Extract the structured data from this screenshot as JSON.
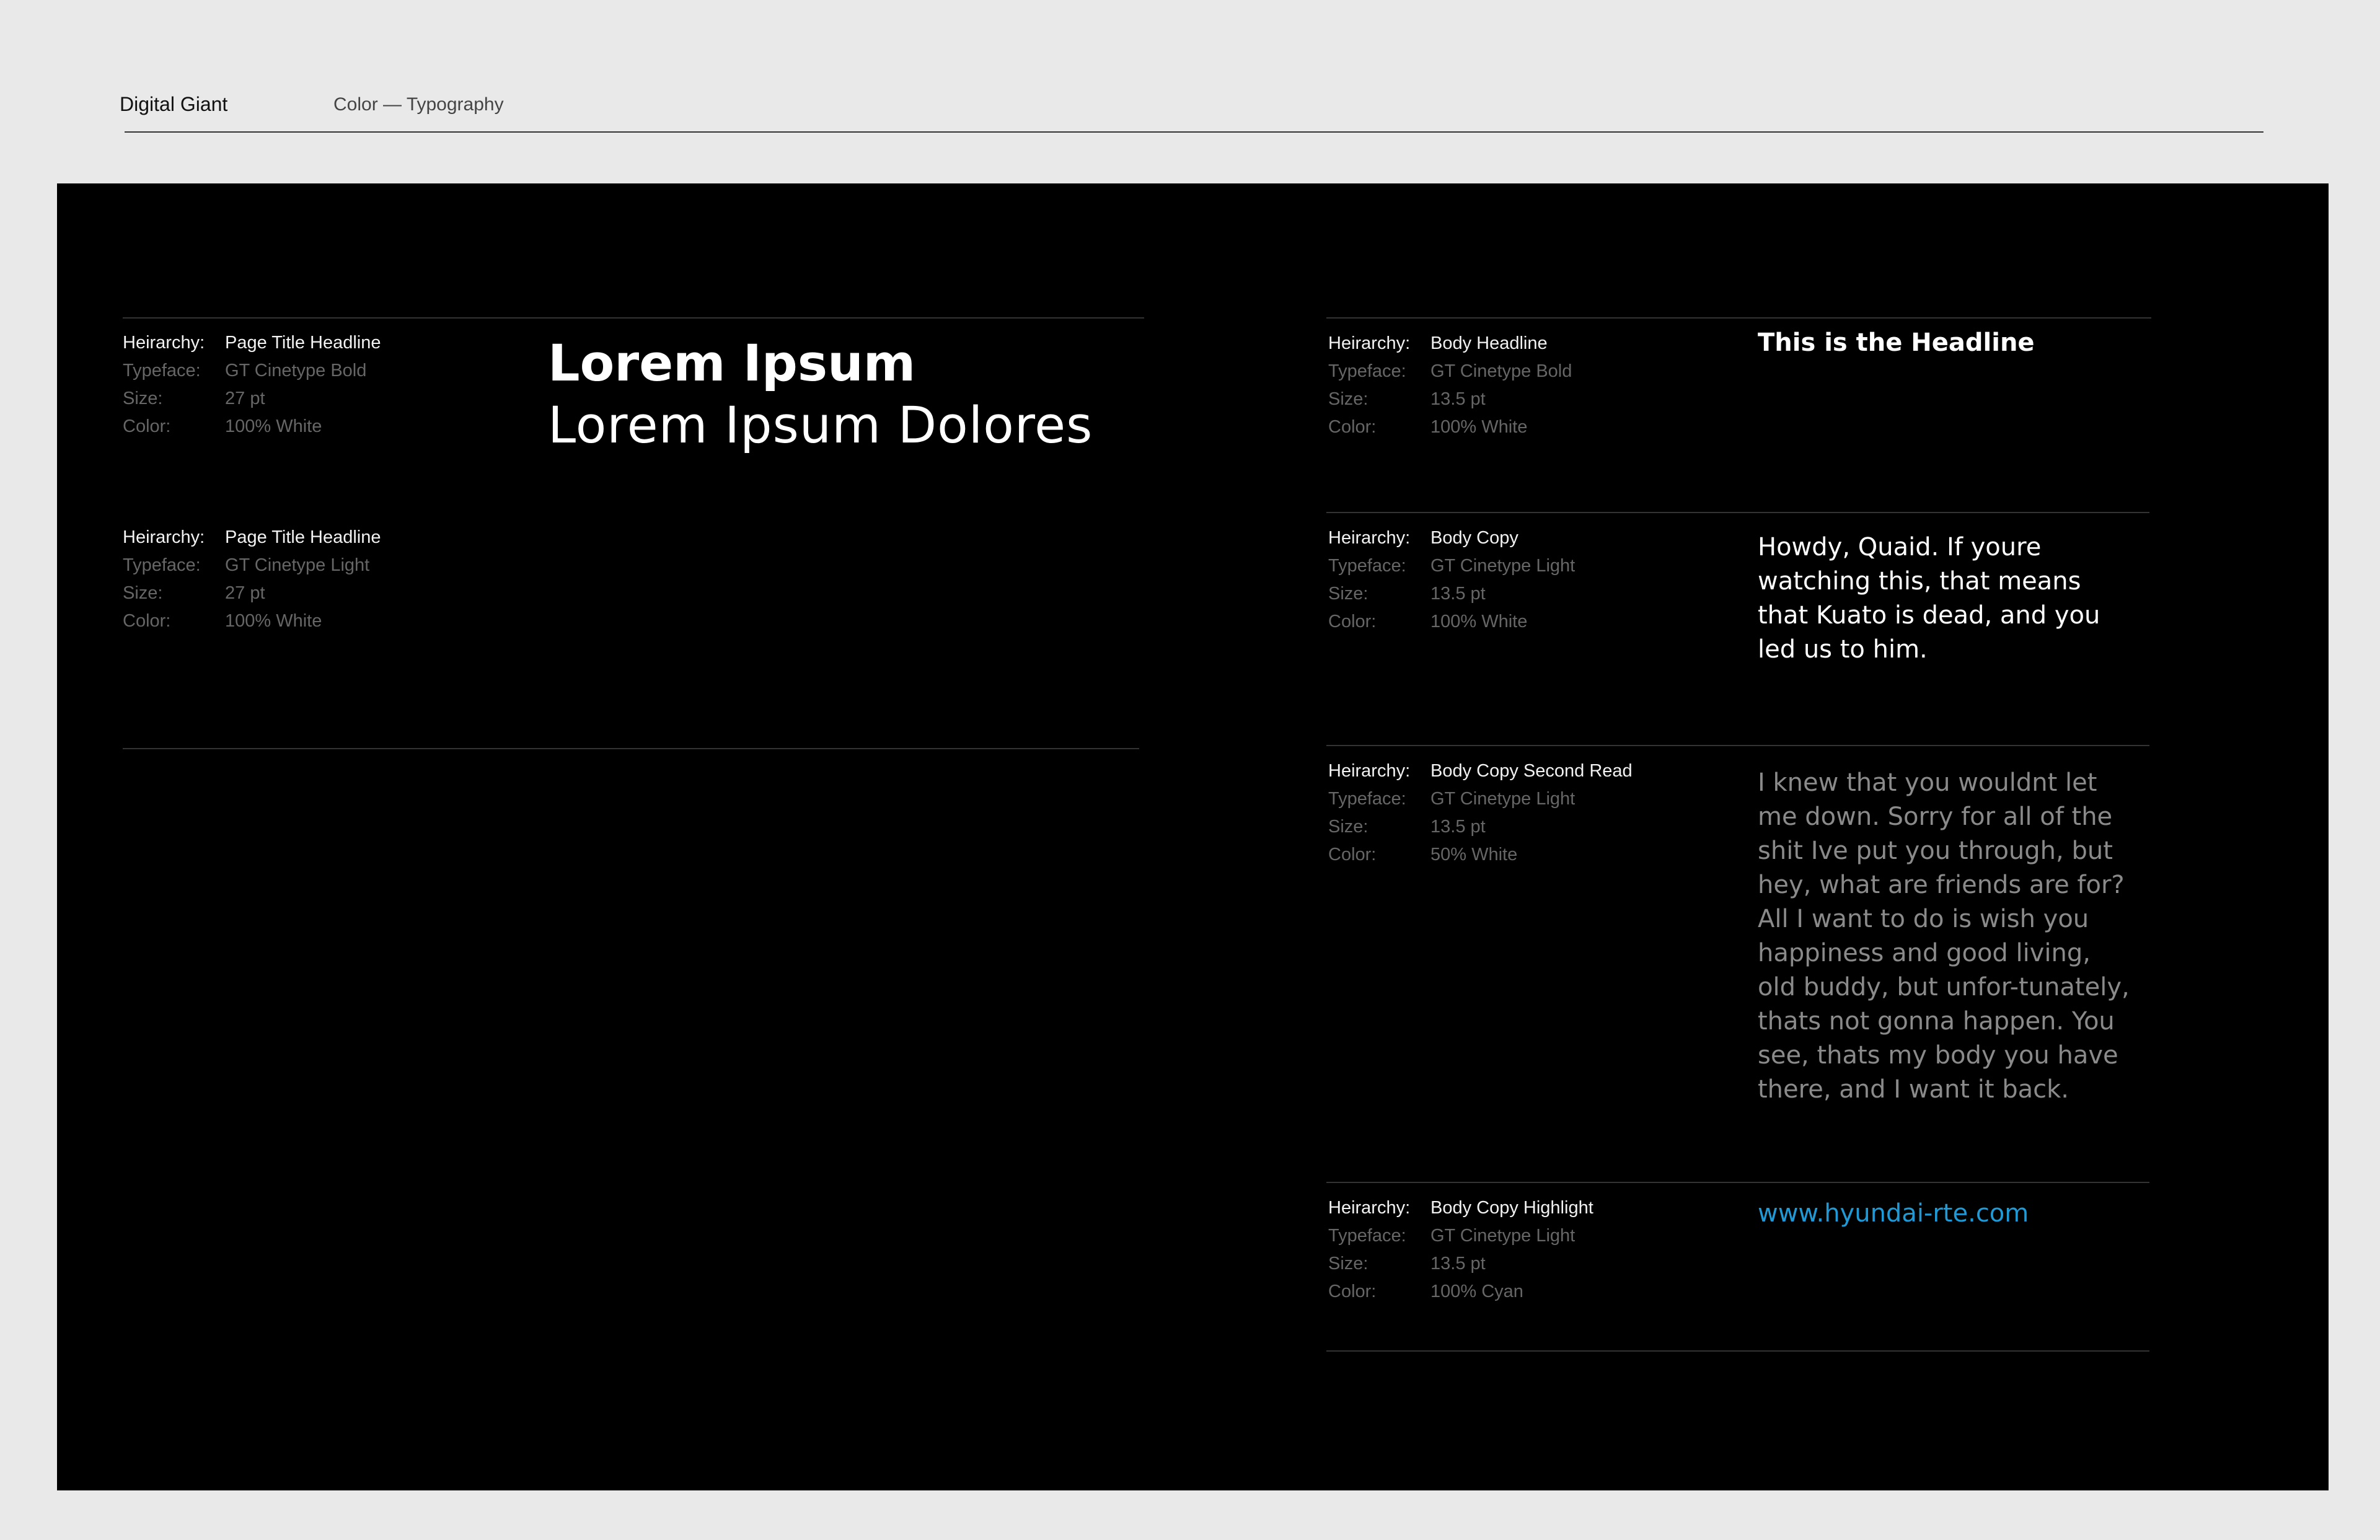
{
  "header": {
    "brand": "Digital Giant",
    "section": "Color — Typography"
  },
  "colors": {
    "panel": "#000000",
    "white": "#ffffff",
    "half_white": "#8a8a8a",
    "cyan": "#1f9ad6"
  },
  "spec_labels": {
    "hierarchy": "Heirarchy:",
    "typeface": "Typeface:",
    "size": "Size:",
    "color": "Color:"
  },
  "left_specs": [
    {
      "hierarchy": "Page Title Headline",
      "typeface": "GT Cinetype Bold",
      "size": "27 pt",
      "color": "100% White"
    },
    {
      "hierarchy": "Page Title Headline",
      "typeface": "GT Cinetype Light",
      "size": "27 pt",
      "color": "100% White"
    }
  ],
  "left_samples": {
    "bold": "Lorem Ipsum",
    "light": "Lorem Ipsum Dolores"
  },
  "right_specs": [
    {
      "hierarchy": "Body Headline",
      "typeface": "GT Cinetype Bold",
      "size": "13.5 pt",
      "color": "100% White",
      "sample": "This is the Headline"
    },
    {
      "hierarchy": "Body Copy",
      "typeface": "GT Cinetype Light",
      "size": "13.5 pt",
      "color": "100% White",
      "sample": "Howdy, Quaid. If youre watching this, that means that Kuato is dead, and you led us to him."
    },
    {
      "hierarchy": "Body Copy Second Read",
      "typeface": "GT Cinetype Light",
      "size": "13.5 pt",
      "color": "50% White",
      "sample": "I knew that you wouldnt let me down. Sorry for all of the shit Ive put you through, but hey, what are friends are for? All I want to do is wish you happiness and good living, old buddy, but unfor-tunately, thats not gonna happen. You see, thats my body you have there, and I want it back."
    },
    {
      "hierarchy": "Body Copy Highlight",
      "typeface": "GT Cinetype Light",
      "size": "13.5 pt",
      "color": "100% Cyan",
      "sample": "www.hyundai-rte.com"
    }
  ]
}
